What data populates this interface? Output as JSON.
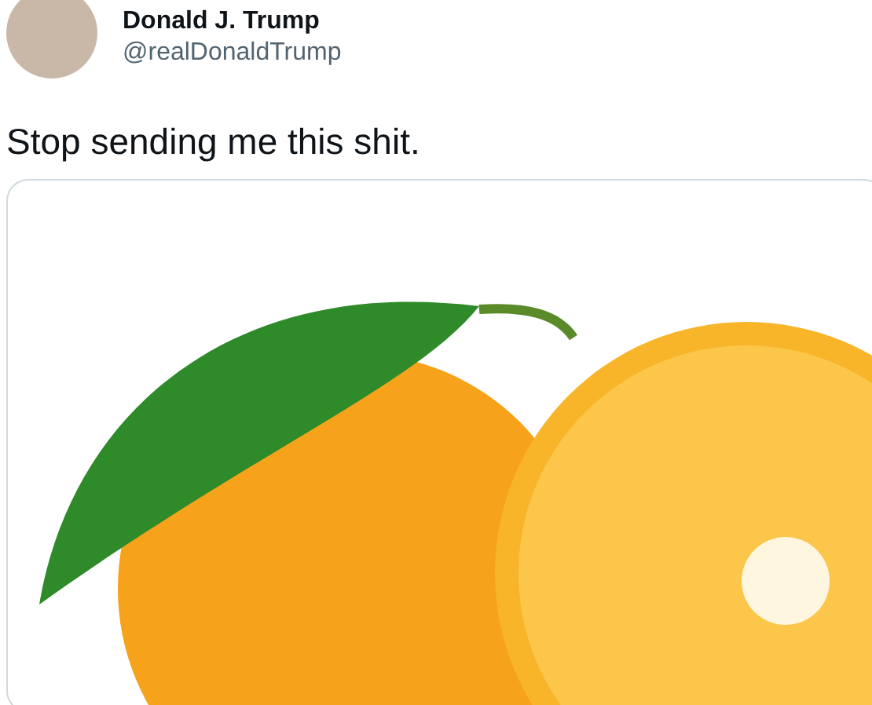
{
  "author": {
    "name": "Donald J. Trump",
    "handle": "@realDonaldTrump"
  },
  "tweet": {
    "text": "Stop sending me this shit."
  }
}
